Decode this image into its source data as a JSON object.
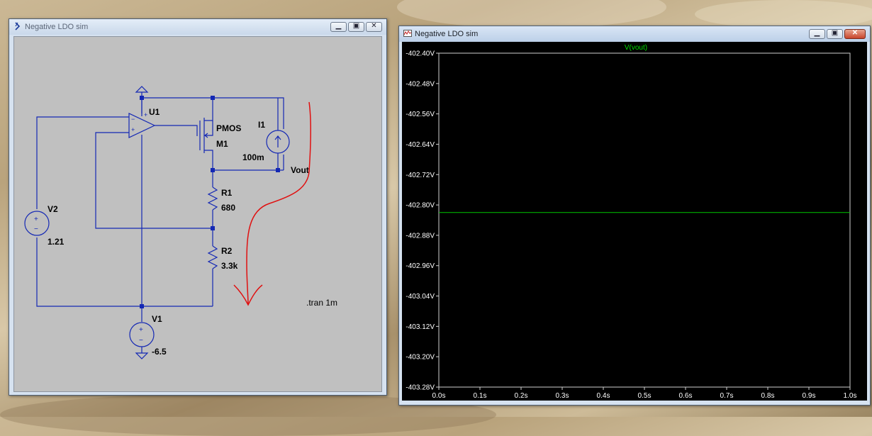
{
  "schematic_window": {
    "title": "Negative LDO sim",
    "labels": {
      "u1": "U1",
      "pmos_model": "PMOS",
      "m1": "M1",
      "i1": "I1",
      "i1_value": "100m",
      "vout": "Vout",
      "r1": "R1",
      "r1_value": "680",
      "v2": "V2",
      "v2_value": "1.21",
      "r2": "R2",
      "r2_value": "3.3k",
      "v1": "V1",
      "v1_value": "-6.5",
      "directive": ".tran 1m",
      "opamp_plus": "+",
      "opamp_minus": "−",
      "src_plus": "+",
      "src_minus": "−"
    }
  },
  "plot_window": {
    "title": "Negative LDO sim",
    "trace_label": "V(vout)",
    "colors": {
      "background": "#000000",
      "trace": "#00c800",
      "trace_label": "#00e000",
      "axis_text": "#ffffff"
    }
  },
  "chart_data": {
    "type": "line",
    "title": "V(vout)",
    "xlabel": "",
    "ylabel": "",
    "xlim": [
      0,
      1.0
    ],
    "ylim": [
      -403.28,
      -402.4
    ],
    "x_ticks": [
      "0.0s",
      "0.1s",
      "0.2s",
      "0.3s",
      "0.4s",
      "0.5s",
      "0.6s",
      "0.7s",
      "0.8s",
      "0.9s",
      "1.0s"
    ],
    "y_ticks": [
      "-402.40V",
      "-402.48V",
      "-402.56V",
      "-402.64V",
      "-402.72V",
      "-402.80V",
      "-402.88V",
      "-402.96V",
      "-403.04V",
      "-403.12V",
      "-403.20V",
      "-403.28V"
    ],
    "series": [
      {
        "name": "V(vout)",
        "x": [
          0.0,
          1.0
        ],
        "y": [
          -402.82,
          -402.82
        ]
      }
    ],
    "grid": false
  }
}
